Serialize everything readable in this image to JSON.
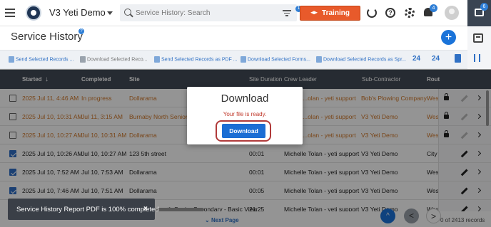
{
  "header": {
    "app_title": "V3 Yeti Demo",
    "search_placeholder": "Service History: Search",
    "filter_badge": "1",
    "training_label": "Training",
    "notifications_count": "4",
    "chat_count": "6"
  },
  "page": {
    "title": "Service History",
    "info_glyph": "?"
  },
  "toolbar": {
    "items": [
      "Send Selected Records ...",
      "Download Selected Reco...",
      "Send Selected Records as PDF ...",
      "Download Selected Forms...",
      "Download Selected Records as Spr..."
    ],
    "icon_24": "24",
    "icon_24b": "24"
  },
  "table": {
    "columns": {
      "started": "Started",
      "completed": "Completed",
      "site": "Site",
      "duration": "Site Duration",
      "crew": "Crew Leader",
      "subcontractor": "Sub-Contractor",
      "route": "Rout"
    },
    "rows": [
      {
        "started": "2025 Jul 11, 4:46 AM",
        "completed": "In progress",
        "site": "Dollarama",
        "duration": "",
        "crew": "...olan - yeti support",
        "sub": "Bob's Plowing Company",
        "route": "West"
      },
      {
        "started": "2025 Jul 10, 10:31 AM",
        "completed": "Jul 11, 3:15 AM",
        "site": "Burnaby North Senior",
        "duration": "",
        "crew": "...olan - yeti support",
        "sub": "V3 Yeti Demo",
        "route": "West"
      },
      {
        "started": "2025 Jul 10, 10:27 AM",
        "completed": "Jul 10, 10:31 AM",
        "site": "Dollarama",
        "duration": "",
        "crew": "...olan - yeti support",
        "sub": "V3 Yeti Demo",
        "route": "West"
      },
      {
        "started": "2025 Jul 10, 10:26 AM",
        "completed": "Jul 10, 10:27 AM",
        "site": "123 5th street",
        "duration": "00:01",
        "crew": "Michelle Tolan - yeti support",
        "sub": "V3 Yeti Demo",
        "route": "City o"
      },
      {
        "started": "2025 Jul 10, 7:52 AM",
        "completed": "Jul 10, 7:53 AM",
        "site": "Dollarama",
        "duration": "00:01",
        "crew": "Michelle Tolan - yeti support",
        "sub": "V3 Yeti Demo",
        "route": "West"
      },
      {
        "started": "2025 Jul 10, 7:46 AM",
        "completed": "Jul 10, 7:51 AM",
        "site": "Dollarama",
        "duration": "00:05",
        "crew": "Michelle Tolan - yeti support",
        "sub": "V3 Yeti Demo",
        "route": "West"
      },
      {
        "started": "",
        "completed": "",
        "site": "orth Senior Secondary - Basic View",
        "duration": "21:25",
        "crew": "Michelle Tolan - yeti support",
        "sub": "V3 Yeti Demo",
        "route": "West"
      }
    ]
  },
  "footer": {
    "next_page": "Next Page",
    "records": "0 of 2413 records",
    "up_glyph": "^",
    "prev_glyph": "<",
    "next_glyph": ">"
  },
  "toast": {
    "message": "Service History Report PDF is 100% completed",
    "close": "×"
  },
  "modal": {
    "title": "Download",
    "message": "Your file is ready.",
    "button": "Download"
  },
  "colors": {
    "accent": "#1b6ed4",
    "training": "#e85a2b",
    "pending_row_text": "#d0782a",
    "table_header": "#434b57"
  }
}
